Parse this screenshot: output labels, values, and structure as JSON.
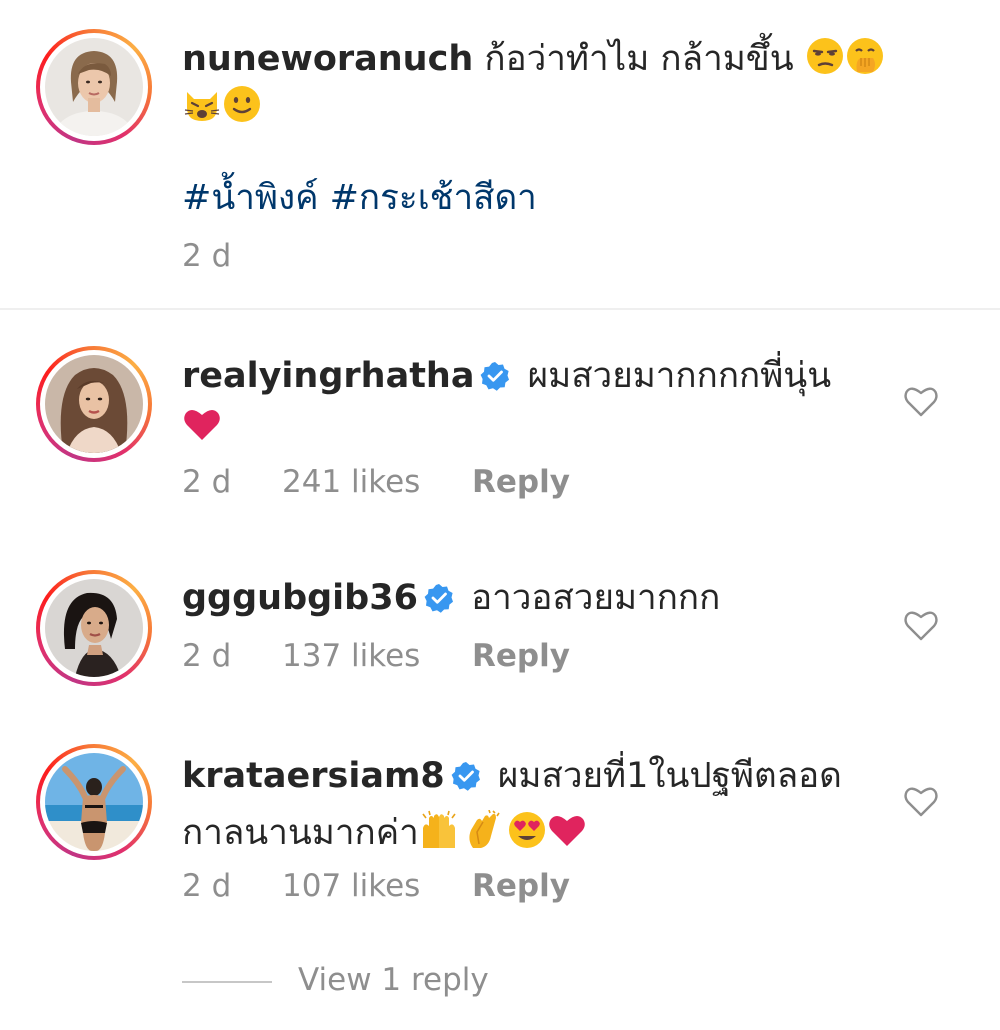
{
  "caption": {
    "username": "nuneworanuch",
    "text": "ก้อว่าทำไม กล้ามขึ้น",
    "hashtags": "#น้ำพิงค์ #กระเช้าสีดา",
    "time": "2 d",
    "emojis": [
      "unamused-face-emoji",
      "face-with-hand-over-mouth-emoji",
      "weary-cat-emoji",
      "slightly-smiling-face-emoji"
    ]
  },
  "comments": [
    {
      "username": "realyingrhatha",
      "verified": true,
      "text": "ผมสวยมากกกกพี่นุ่น",
      "emojis": [
        "red-heart-emoji"
      ],
      "time": "2 d",
      "likes": "241 likes",
      "reply": "Reply"
    },
    {
      "username": "gggubgib36",
      "verified": true,
      "text": "อาวอสวยมากกก",
      "emojis": [],
      "time": "2 d",
      "likes": "137 likes",
      "reply": "Reply"
    },
    {
      "username": "krataersiam8",
      "verified": true,
      "text_line1": "ผมสวยที่1ในปฐพีตลอด",
      "text_line2": "กาลนานมากค่า",
      "emojis": [
        "raising-hands-emoji",
        "clapping-hands-emoji",
        "heart-eyes-emoji",
        "red-heart-emoji"
      ],
      "time": "2 d",
      "likes": "107 likes",
      "reply": "Reply"
    }
  ],
  "view_replies": "View 1 reply",
  "colors": {
    "text": "#262626",
    "muted": "#8e8e8e",
    "hashtag": "#00376b",
    "verified": "#3897f0",
    "heart": "#e0245e"
  }
}
